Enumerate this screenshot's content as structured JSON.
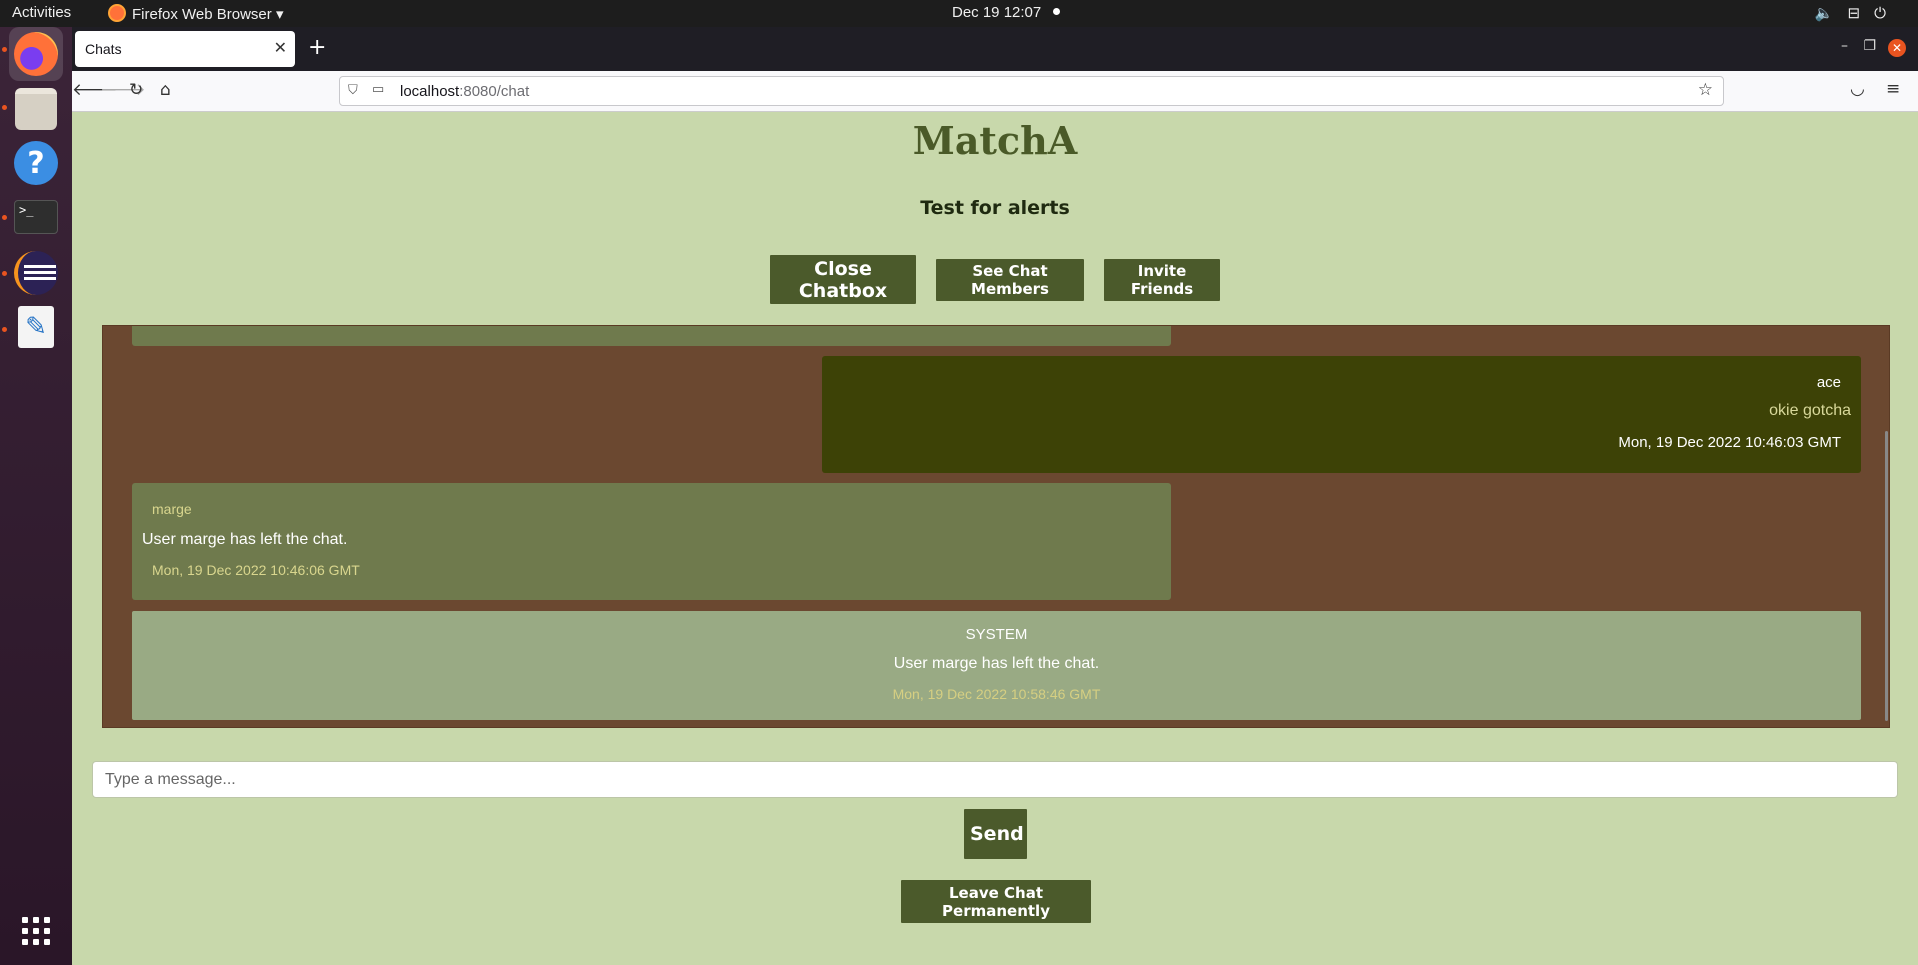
{
  "system_bar": {
    "activities": "Activities",
    "app_name": "Firefox Web Browser",
    "app_menu_arrow": "▾",
    "clock": "Dec 19  12:07",
    "tray_icons": [
      "volume-icon",
      "network-icon",
      "power-icon"
    ]
  },
  "dock": {
    "apps": [
      "firefox-icon",
      "files-icon",
      "help-icon",
      "terminal-icon",
      "eclipse-icon",
      "text-editor-icon"
    ],
    "show_apps": "apps-grid-icon"
  },
  "browser": {
    "tab_title": "Chats",
    "new_tab": "+",
    "url_host": "localhost",
    "url_rest": ":8080/chat"
  },
  "page": {
    "app_title": "MatchA",
    "chat_name": "Test for alerts",
    "buttons": {
      "close_chatbox": "Close Chatbox",
      "see_members": "See Chat Members",
      "invite": "Invite Friends",
      "send": "Send",
      "leave": "Leave Chat Permanently"
    },
    "input_placeholder": "Type a message...",
    "messages": [
      {
        "sender": "ace",
        "text": "okie gotcha",
        "time": "Mon, 19 Dec 2022 10:46:03 GMT",
        "align": "right"
      },
      {
        "sender": "marge",
        "text": "User marge has left the chat.",
        "time": "Mon, 19 Dec 2022 10:46:06 GMT",
        "align": "left"
      },
      {
        "sender": "SYSTEM",
        "text": "User marge has left the chat.",
        "time": "Mon, 19 Dec 2022 10:58:46 GMT",
        "align": "center"
      }
    ]
  },
  "colors": {
    "page_bg": "#c8d8ab",
    "button_bg": "#4b5a2b",
    "chatbox_bg": "#6b4830",
    "own_message_bg": "#3d4206",
    "other_message_bg": "#6f7a4d",
    "system_message_bg": "#99aa84"
  }
}
